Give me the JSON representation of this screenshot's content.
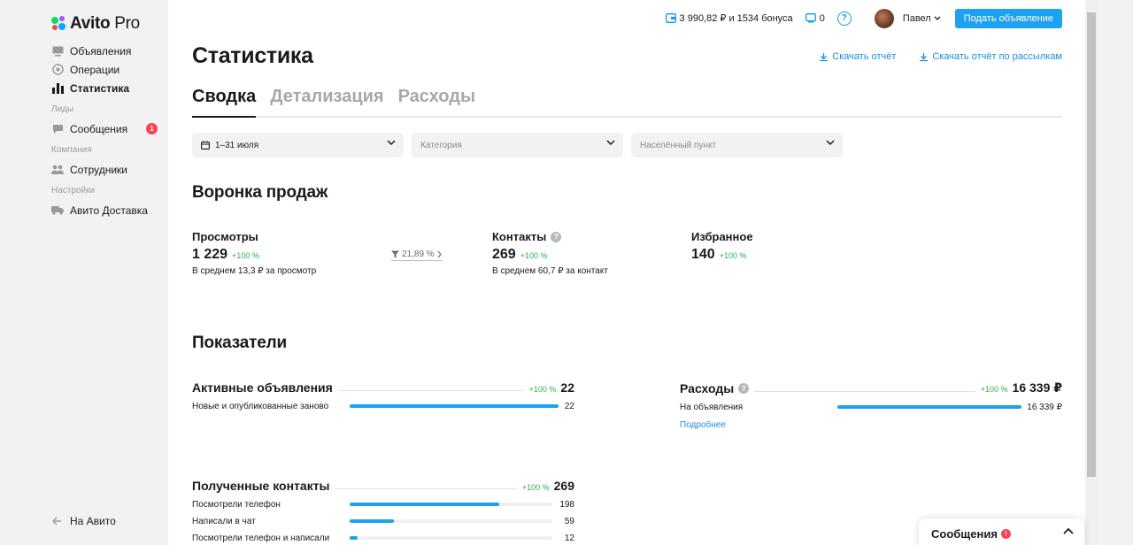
{
  "brand": {
    "name": "Avito",
    "suffix": "Pro"
  },
  "sidebar": {
    "items": [
      {
        "label": "Объявления",
        "icon": "listing-icon"
      },
      {
        "label": "Операции",
        "icon": "operations-icon"
      },
      {
        "label": "Статистика",
        "icon": "stats-icon",
        "active": true
      }
    ],
    "sections": [
      {
        "title": "Лиды",
        "items": [
          {
            "label": "Сообщения",
            "icon": "chat-icon",
            "badge": "1"
          }
        ]
      },
      {
        "title": "Компания",
        "items": [
          {
            "label": "Сотрудники",
            "icon": "people-icon"
          }
        ]
      },
      {
        "title": "Настройки",
        "items": [
          {
            "label": "Авито Доставка",
            "icon": "truck-icon"
          }
        ]
      }
    ],
    "back_link": "На Авито"
  },
  "topbar": {
    "wallet": "3 990,82 ₽ и 1534 бонуса",
    "notifications_count": "0",
    "help_label": "?",
    "user_name": "Павел",
    "post_button": "Подать объявление"
  },
  "page": {
    "title": "Статистика",
    "download_report": "Скачать отчёт",
    "download_mailing": "Скачать отчёт по рассылкам",
    "tabs": [
      "Сводка",
      "Детализация",
      "Расходы"
    ],
    "filters": {
      "period": "1–31 июля",
      "category_placeholder": "Категория",
      "location_placeholder": "Населённый пункт"
    }
  },
  "funnel": {
    "title": "Воронка продаж",
    "views": {
      "label": "Просмотры",
      "value": "1 229",
      "change": "+100 %",
      "sub": "В среднем 13,3 ₽ за просмотр"
    },
    "conversion": "21,89 %",
    "contacts": {
      "label": "Контакты",
      "value": "269",
      "change": "+100 %",
      "sub": "В среднем 60,7 ₽ за контакт"
    },
    "favorites": {
      "label": "Избранное",
      "value": "140",
      "change": "+100 %"
    }
  },
  "metrics": {
    "title": "Показатели",
    "active_listings": {
      "title": "Активные объявления",
      "change": "+100 %",
      "total": "22",
      "rows": [
        {
          "label": "Новые и опубликованные заново",
          "value": "22",
          "fraction": 1.0
        }
      ]
    },
    "expenses": {
      "title": "Расходы",
      "change": "+100 %",
      "total": "16 339 ₽",
      "rows": [
        {
          "label": "На объявления",
          "value": "16 339 ₽",
          "fraction": 1.0
        }
      ],
      "more": "Подробнее"
    },
    "contacts": {
      "title": "Полученные контакты",
      "change": "+100 %",
      "total": "269",
      "rows": [
        {
          "label": "Посмотрели телефон",
          "value": "198",
          "fraction": 0.74
        },
        {
          "label": "Написали в чат",
          "value": "59",
          "fraction": 0.22
        },
        {
          "label": "Посмотрели телефон и написали",
          "value": "12",
          "fraction": 0.04
        }
      ]
    }
  },
  "chat_widget": {
    "label": "Сообщения",
    "badge": "!"
  }
}
